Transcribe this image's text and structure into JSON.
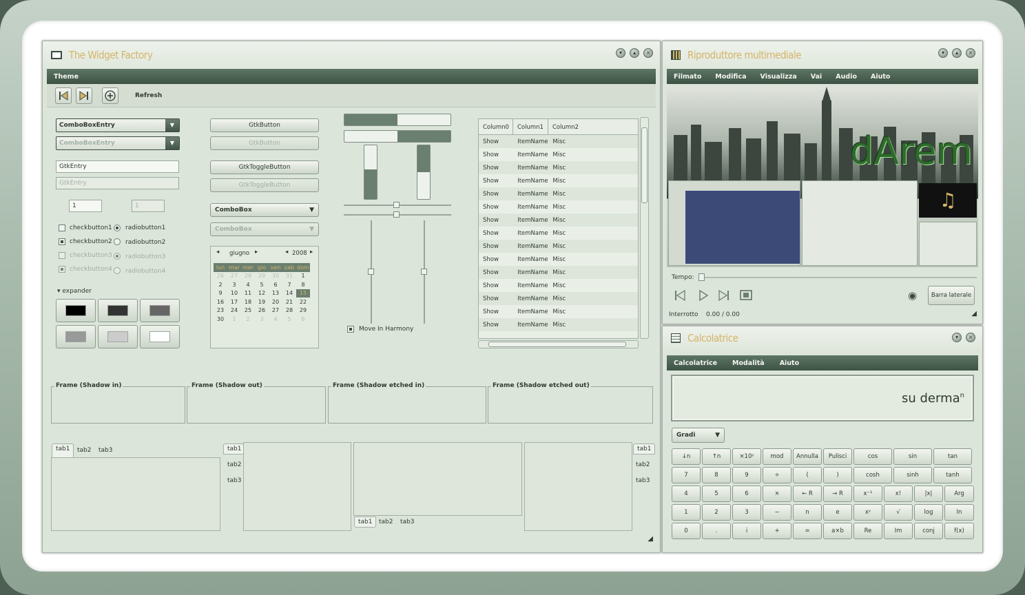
{
  "widget_factory": {
    "title": "The Widget Factory",
    "menu": [
      "Theme"
    ],
    "toolbar": {
      "refresh_label": "Refresh"
    },
    "combo_entry": "ComboBoxEntry",
    "combo_entry_disabled": "ComboBoxEntry",
    "entry": "GtkEntry",
    "entry_disabled": "GtkEntry",
    "spin": "1",
    "spin_disabled": "1",
    "checks": [
      "checkbutton1",
      "checkbutton2",
      "checkbutton3",
      "checkbutton4"
    ],
    "radios": [
      "radiobutton1",
      "radiobutton2",
      "radiobutton3",
      "radiobutton4"
    ],
    "expander": "expander",
    "buttons": {
      "gtk_button": "GtkButton",
      "gtk_button_disabled": "GtkButton",
      "toggle": "GtkToggleButton",
      "toggle_disabled": "GtkToggleButton",
      "combo": "ComboBox",
      "combo_disabled": "ComboBox"
    },
    "calendar": {
      "month": "giugno",
      "year": "2008",
      "days": [
        "lun",
        "mar",
        "mer",
        "gio",
        "ven",
        "sab",
        "dom"
      ],
      "selected_day": "15",
      "weeks": [
        [
          "26",
          "27",
          "28",
          "29",
          "30",
          "31",
          "1"
        ],
        [
          "2",
          "3",
          "4",
          "5",
          "6",
          "7",
          "8"
        ],
        [
          "9",
          "10",
          "11",
          "12",
          "13",
          "14",
          "15"
        ],
        [
          "16",
          "17",
          "18",
          "19",
          "20",
          "21",
          "22"
        ],
        [
          "23",
          "24",
          "25",
          "26",
          "27",
          "28",
          "29"
        ],
        [
          "30",
          "1",
          "2",
          "3",
          "4",
          "5",
          "6"
        ]
      ]
    },
    "harmony": "Move In Harmony",
    "tree": {
      "columns": [
        "Column0",
        "Column1",
        "Column2"
      ],
      "row": [
        "Show",
        "ItemName",
        "Misc"
      ],
      "row_count": 15
    },
    "progress": {
      "bar1": 0.5,
      "bar2": 0.5
    },
    "vbars": {
      "left": 0.55,
      "right": 0.5
    },
    "frames": [
      "Frame (Shadow in)",
      "Frame (Shadow out)",
      "Frame (Shadow etched in)",
      "Frame (Shadow etched out)"
    ],
    "tabs": [
      "tab1",
      "tab2",
      "tab3"
    ]
  },
  "media": {
    "title": "Riproduttore multimediale",
    "menu": [
      "Filmato",
      "Modifica",
      "Visualizza",
      "Vai",
      "Audio",
      "Aiuto"
    ],
    "overlay_text": "dArem",
    "tempo_label": "Tempo:",
    "sidebar_button": "Barra laterale",
    "status": "Interrotto",
    "time": "0.00 / 0.00"
  },
  "calc": {
    "title": "Calcolatrice",
    "menu": [
      "Calcolatrice",
      "Modalità",
      "Aiuto"
    ],
    "display": "su derma",
    "display_sup": "n",
    "angle_mode": "Gradi",
    "keys": [
      [
        "↓n",
        "↑n",
        "×10ʸ",
        "mod",
        "Annulla",
        "Pulisci",
        "cos",
        "sin",
        "tan"
      ],
      [
        "7",
        "8",
        "9",
        "÷",
        "(",
        ")",
        "cosh",
        "sinh",
        "tanh"
      ],
      [
        "4",
        "5",
        "6",
        "×",
        "← R",
        "→ R",
        "x⁻¹",
        "x!",
        "|x|",
        "Arg"
      ],
      [
        "1",
        "2",
        "3",
        "−",
        "n",
        "e",
        "xʸ",
        "√",
        "log",
        "ln"
      ],
      [
        "0",
        ".",
        "i",
        "+",
        "=",
        "a×b",
        "Re",
        "Im",
        "conj",
        "f(x)"
      ]
    ]
  },
  "colors": {
    "accent": "#d4b468",
    "menubar": "#4a5f51",
    "window": "#dce5da"
  }
}
